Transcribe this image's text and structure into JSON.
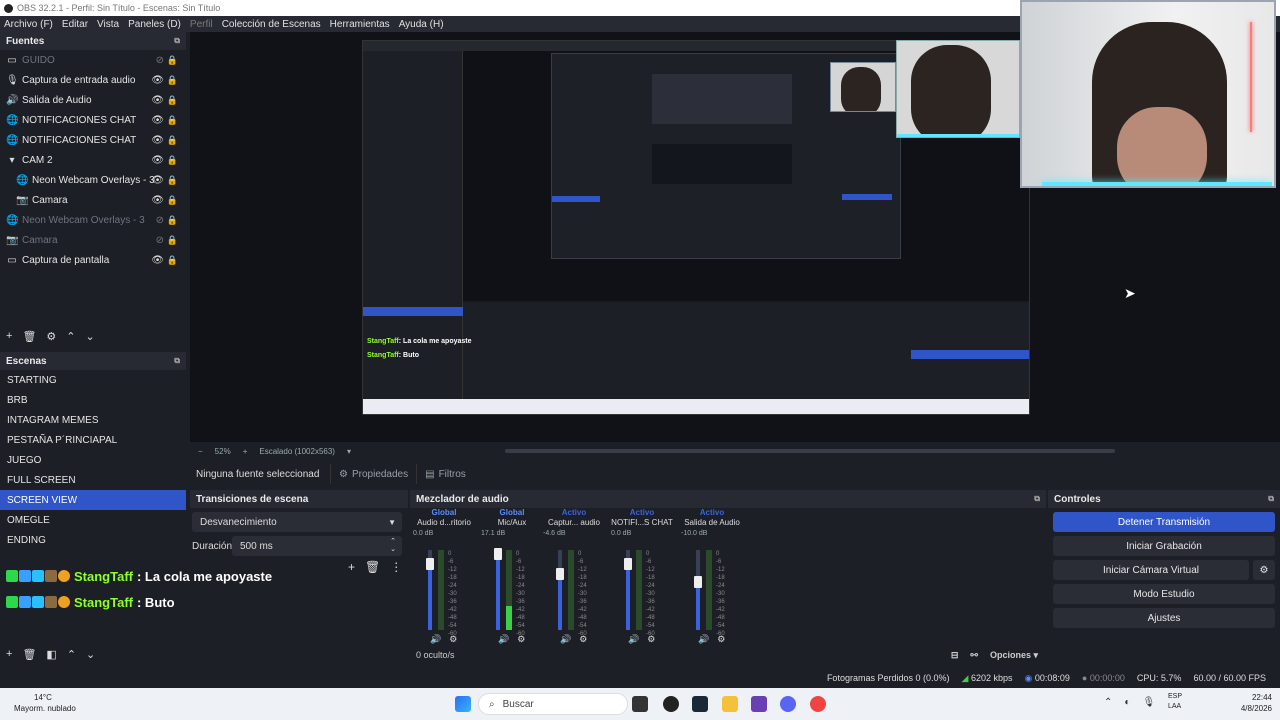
{
  "window": {
    "title": "OBS 32.2.1 - Perfil: Sin Título - Escenas: Sin Título"
  },
  "menu": [
    {
      "label": "Archivo (F)",
      "dim": false
    },
    {
      "label": "Editar",
      "dim": false
    },
    {
      "label": "Vista",
      "dim": false
    },
    {
      "label": "Paneles (D)",
      "dim": false
    },
    {
      "label": "Perfil",
      "dim": true
    },
    {
      "label": "Colección de Escenas",
      "dim": false
    },
    {
      "label": "Herramientas",
      "dim": false
    },
    {
      "label": "Ayuda (H)",
      "dim": false
    }
  ],
  "sources": {
    "title": "Fuentes",
    "items": [
      {
        "label": "GUIDO",
        "icon": "group-icon",
        "visible": false,
        "indent": 0
      },
      {
        "label": "Captura de entrada audio",
        "icon": "microphone-icon",
        "visible": true,
        "indent": 0
      },
      {
        "label": "Salida de Audio",
        "icon": "speaker-icon",
        "visible": true,
        "indent": 0
      },
      {
        "label": "NOTIFICACIONES CHAT",
        "icon": "globe-icon",
        "visible": true,
        "indent": 0
      },
      {
        "label": "NOTIFICACIONES CHAT",
        "icon": "globe-icon",
        "visible": true,
        "indent": 0
      },
      {
        "label": "CAM 2",
        "icon": "folder-icon",
        "visible": true,
        "indent": 0
      },
      {
        "label": "Neon Webcam Overlays - 3",
        "icon": "globe-icon",
        "visible": true,
        "indent": 1
      },
      {
        "label": "Camara",
        "icon": "camera-icon",
        "visible": true,
        "indent": 1
      },
      {
        "label": "Neon Webcam Overlays - 3",
        "icon": "globe-icon",
        "visible": false,
        "indent": 0
      },
      {
        "label": "Camara",
        "icon": "camera-icon",
        "visible": false,
        "indent": 0
      },
      {
        "label": "Captura de pantalla",
        "icon": "monitor-icon",
        "visible": true,
        "indent": 0
      }
    ]
  },
  "scenes": {
    "title": "Escenas",
    "items": [
      "STARTING",
      "BRB",
      "INTAGRAM MEMES",
      "PESTAÑA P´RINCIAPAL",
      "JUEGO",
      "FULL SCREEN",
      "SCREEN VIEW",
      "OMEGLE",
      "ENDING"
    ],
    "selected": "SCREEN VIEW"
  },
  "chat": [
    {
      "name": "StangTaff",
      "message": ": La cola me apoyaste"
    },
    {
      "name": "StangTaff",
      "message": ": Buto"
    }
  ],
  "preview": {
    "zoom": "52%",
    "scaling": "Escalado (1002x563)"
  },
  "props_bar": {
    "no_source": "Ninguna fuente seleccionad",
    "properties": "Propiedades",
    "filters": "Filtros"
  },
  "transitions": {
    "title": "Transiciones de escena",
    "type": "Desvanecimiento",
    "duration_label": "Duración",
    "duration": "500 ms"
  },
  "mixer": {
    "title": "Mezclador de audio",
    "channels": [
      {
        "status": "Global",
        "name": "Audio d...ritorio",
        "db": "0.0 dB",
        "fader": 0.82,
        "level": 0.0,
        "status_color": "#5b8cff"
      },
      {
        "status": "Global",
        "name": "Mic/Aux",
        "db": "17.1 dB",
        "fader": 0.95,
        "level": 0.3,
        "status_color": "#5b8cff"
      },
      {
        "status": "Activo",
        "name": "Captur... audio",
        "db": "-4.6 dB",
        "fader": 0.7,
        "level": 0.0,
        "status_color": "#3a62e0"
      },
      {
        "status": "Activo",
        "name": "NOTIFI...S CHAT",
        "db": "0.0 dB",
        "fader": 0.82,
        "level": 0.0,
        "status_color": "#3a62e0"
      },
      {
        "status": "Activo",
        "name": "Salida de Audio",
        "db": "-10.0 dB",
        "fader": 0.6,
        "level": 0.0,
        "status_color": "#3a62e0"
      }
    ],
    "scale": [
      "0",
      "-6",
      "-12",
      "-18",
      "-24",
      "-30",
      "-36",
      "-42",
      "-48",
      "-54",
      "-60"
    ],
    "hidden": "0 oculto/s",
    "options": "Opciones"
  },
  "controls": {
    "title": "Controles",
    "buttons": [
      "Detener Transmisión",
      "Iniciar Grabación",
      "Iniciar Cámara Virtual",
      "Modo Estudio",
      "Ajustes"
    ]
  },
  "status": {
    "dropped": "Fotogramas Perdidos 0 (0.0%)",
    "kbps": "6202 kbps",
    "stream_time": "00:08:09",
    "rec_time": "00:00:00",
    "cpu": "CPU: 5.7%",
    "fps": "60.00 / 60.00 FPS"
  },
  "taskbar": {
    "temp": "14°C",
    "weather": "Mayorm. nublado",
    "search": "Buscar",
    "lang1": "ESP",
    "lang2": "LAA",
    "time": "22:44",
    "date": "4/8/2026"
  },
  "colors": {
    "accent": "#2f55c8",
    "chat_name": "#8fff2a"
  }
}
